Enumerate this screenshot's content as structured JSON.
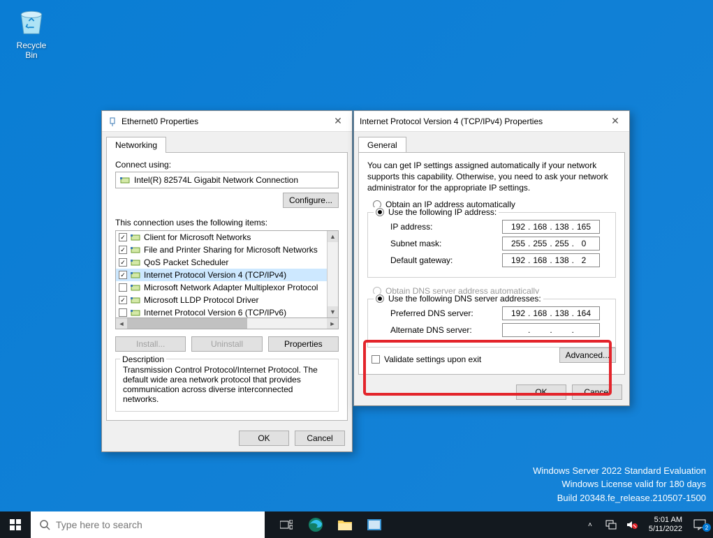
{
  "desktop": {
    "recycle_bin": "Recycle Bin"
  },
  "watermark": {
    "l1": "Windows Server 2022 Standard Evaluation",
    "l2": "Windows License valid for 180 days",
    "l3": "Build 20348.fe_release.210507-1500"
  },
  "dlg1": {
    "title": "Ethernet0 Properties",
    "tab": "Networking",
    "connect_using": "Connect using:",
    "adapter": "Intel(R) 82574L Gigabit Network Connection",
    "configure": "Configure...",
    "items_label": "This connection uses the following items:",
    "items": [
      {
        "checked": true,
        "label": "Client for Microsoft Networks"
      },
      {
        "checked": true,
        "label": "File and Printer Sharing for Microsoft Networks"
      },
      {
        "checked": true,
        "label": "QoS Packet Scheduler"
      },
      {
        "checked": true,
        "label": "Internet Protocol Version 4 (TCP/IPv4)",
        "selected": true
      },
      {
        "checked": false,
        "label": "Microsoft Network Adapter Multiplexor Protocol"
      },
      {
        "checked": true,
        "label": "Microsoft LLDP Protocol Driver"
      },
      {
        "checked": false,
        "label": "Internet Protocol Version 6 (TCP/IPv6)"
      }
    ],
    "install": "Install...",
    "uninstall": "Uninstall",
    "properties": "Properties",
    "desc_label": "Description",
    "desc_text": "Transmission Control Protocol/Internet Protocol. The default wide area network protocol that provides communication across diverse interconnected networks.",
    "ok": "OK",
    "cancel": "Cancel"
  },
  "dlg2": {
    "title": "Internet Protocol Version 4 (TCP/IPv4) Properties",
    "tab": "General",
    "instr": "You can get IP settings assigned automatically if your network supports this capability. Otherwise, you need to ask your network administrator for the appropriate IP settings.",
    "auto_ip": "Obtain an IP address automatically",
    "use_ip": "Use the following IP address:",
    "ip_label": "IP address:",
    "ip": [
      "192",
      "168",
      "138",
      "165"
    ],
    "mask_label": "Subnet mask:",
    "mask": [
      "255",
      "255",
      "255",
      "0"
    ],
    "gw_label": "Default gateway:",
    "gw": [
      "192",
      "168",
      "138",
      "2"
    ],
    "auto_dns": "Obtain DNS server address automatically",
    "use_dns": "Use the following DNS server addresses:",
    "pref_label": "Preferred DNS server:",
    "pref": [
      "192",
      "168",
      "138",
      "164"
    ],
    "alt_label": "Alternate DNS server:",
    "alt": [
      "",
      "",
      "",
      ""
    ],
    "validate": "Validate settings upon exit",
    "advanced": "Advanced...",
    "ok": "OK",
    "cancel": "Cancel"
  },
  "taskbar": {
    "search_placeholder": "Type here to search",
    "time": "5:01 AM",
    "date": "5/11/2022",
    "notif_count": "2"
  }
}
